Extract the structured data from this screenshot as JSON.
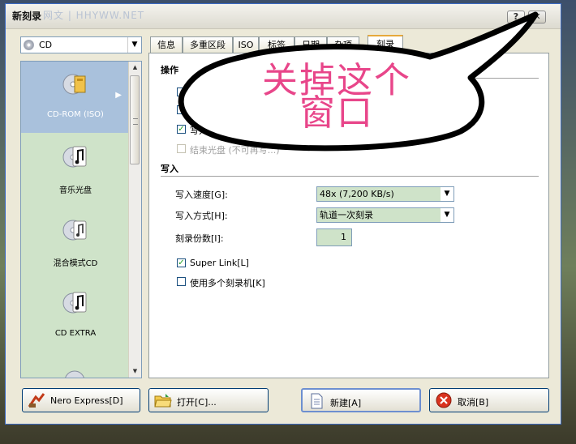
{
  "window": {
    "title": "新刻录",
    "watermark": "网文 | HHYWW.NET",
    "help_label": "?",
    "close_label": "✕"
  },
  "media_combo": {
    "value": "CD",
    "arrow": "▼",
    "icon": "cd-icon"
  },
  "left_panel": {
    "items": [
      {
        "label": "CD-ROM (ISO)",
        "icon": "cd-rom-iso-icon",
        "selected": true
      },
      {
        "label": "音乐光盘",
        "icon": "music-note-icon"
      },
      {
        "label": "混合模式CD",
        "icon": "mixed-mode-cd-icon"
      },
      {
        "label": "CD EXTRA",
        "icon": "cd-extra-icon"
      }
    ],
    "scroll_up": "▲",
    "scroll_down": "▼",
    "selected_arrow": "▶"
  },
  "tabs": [
    {
      "label": "信息"
    },
    {
      "label": "多重区段"
    },
    {
      "label": "ISO"
    },
    {
      "label": "标签"
    },
    {
      "label": "日期"
    },
    {
      "label": "杂项"
    },
    {
      "label": "刻录",
      "active": true
    }
  ],
  "operation": {
    "title": "操作",
    "write_partial": "写入",
    "finalize_label": "结束光盘 (不可再写...)"
  },
  "write": {
    "title": "写入",
    "speed_label": "写入速度[G]:",
    "speed_value": "48x (7,200 KB/s)",
    "method_label": "写入方式[H]:",
    "method_value": "轨道一次刻录",
    "copies_label": "刻录份数[I]:",
    "copies_value": "1",
    "superlink_label": "Super Link[L]",
    "multi_recorder_label": "使用多个刻录机[K]",
    "check_mark": "✓",
    "arrow": "▼"
  },
  "buttons": {
    "nero_express": "Nero Express[D]",
    "open": "打开[C]...",
    "new": "新建[A]",
    "cancel": "取消[B]"
  },
  "annotation": {
    "line1": "关掉这个",
    "line2": "窗口"
  }
}
